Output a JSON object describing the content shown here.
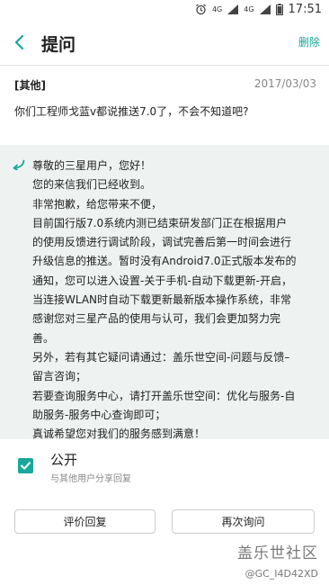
{
  "status_bar": {
    "signal1": "4G",
    "signal2": "4G",
    "battery": "",
    "time": "17:51"
  },
  "header": {
    "title": "提问",
    "delete_label": "删除"
  },
  "question": {
    "tag": "[其他]",
    "date": "2017/03/03",
    "text": "你们工程师戈蓝v都说推送7.0了，不会不知道吧?"
  },
  "answer": {
    "lines": [
      "尊敬的三星用户，您好！",
      "您的来信我们已经收到。",
      "非常抱歉，给您带来不便，",
      "目前国行版7.0系统内测已结束研发部门正在根据用户",
      "的使用反馈进行调试阶段，调试完善后第一时间会进行",
      "升级信息的推送。暂时没有Android7.0正式版本发布的",
      "通知，您可以进入设置-关于手机-自动下载更新-开启，",
      "当连接WLAN时自动下载更新最新版本操作系统，非常",
      "感谢您对三星产品的使用与认可，我们会更加努力完",
      "善。",
      "另外，若有其它疑问请通过：盖乐世空间-问题与反馈–",
      "留言咨询；",
      "若要查询服务中心，请打开盖乐世空间：优化与服务-自",
      "助服务-服务中心查询即可；",
      "真诚希望您对我们的服务感到满意！"
    ]
  },
  "share": {
    "label": "公开",
    "sublabel": "与其他用户分享回复",
    "checked": true
  },
  "buttons": {
    "rate": "评价回复",
    "ask_again": "再次询问"
  },
  "watermark": {
    "logo": "盖乐世社区",
    "user": "@GC_I4D42XD"
  },
  "colors": {
    "accent": "#1aa89a",
    "answer_bg": "#eef2f1"
  }
}
